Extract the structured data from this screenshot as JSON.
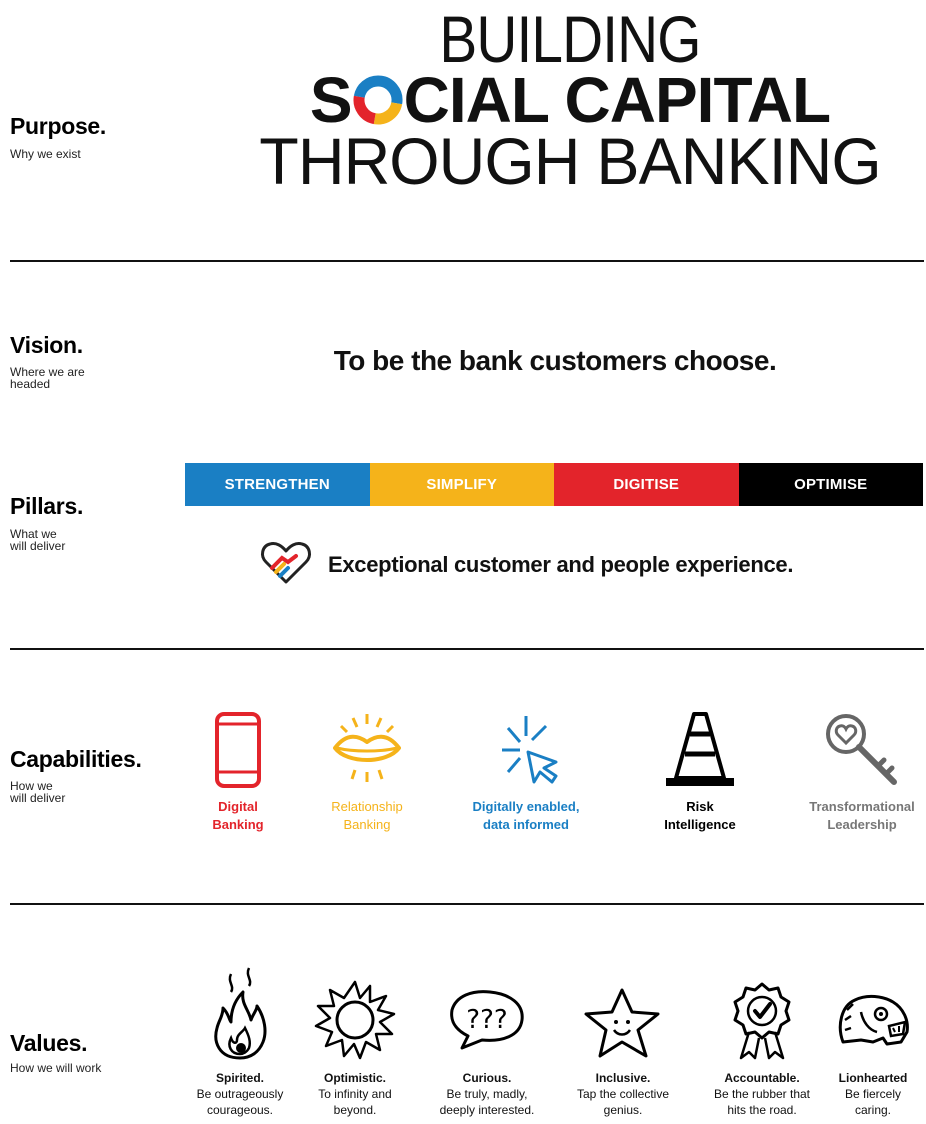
{
  "purpose": {
    "title": "Purpose.",
    "subtitle": "Why we exist",
    "line1": "BUILDING",
    "line2": "SOCIAL CAPITAL",
    "line3": "THROUGH BANKING"
  },
  "vision": {
    "title": "Vision.",
    "subtitle": "Where we are\nheaded",
    "statement": "To be the bank customers choose."
  },
  "pillars": {
    "title": "Pillars.",
    "subtitle": "What we\nwill deliver",
    "items": [
      {
        "label": "STRENGTHEN",
        "color": "#1a7fc4"
      },
      {
        "label": "SIMPLIFY",
        "color": "#f5b31a"
      },
      {
        "label": "DIGITISE",
        "color": "#e3242b"
      },
      {
        "label": "OPTIMISE",
        "color": "#000000"
      }
    ],
    "experience": "Exceptional customer and people experience."
  },
  "capabilities": {
    "title": "Capabilities.",
    "subtitle": "How we\nwill deliver",
    "items": [
      {
        "label": "Digital\nBanking",
        "icon": "phone-icon",
        "color": "#e3242b"
      },
      {
        "label": "Relationship\nBanking",
        "icon": "lips-icon",
        "color": "#f5b31a"
      },
      {
        "label": "Digitally enabled,\ndata informed",
        "icon": "cursor-click-icon",
        "color": "#1a7fc4"
      },
      {
        "label": "Risk\nIntelligence",
        "icon": "traffic-cone-icon",
        "color": "#000000"
      },
      {
        "label": "Transformational\nLeadership",
        "icon": "heart-key-icon",
        "color": "#777777"
      }
    ]
  },
  "values": {
    "title": "Values.",
    "subtitle": "How we will work",
    "items": [
      {
        "name": "Spirited.",
        "desc": "Be outrageously\ncourageous.",
        "icon": "flame-icon"
      },
      {
        "name": "Optimistic.",
        "desc": "To infinity and\nbeyond.",
        "icon": "sun-icon"
      },
      {
        "name": "Curious.",
        "desc": "Be truly, madly,\ndeeply interested.",
        "icon": "question-bubble-icon"
      },
      {
        "name": "Inclusive.",
        "desc": "Tap the collective\ngenius.",
        "icon": "smiling-star-icon"
      },
      {
        "name": "Accountable.",
        "desc": "Be the rubber that\nhits the road.",
        "icon": "rosette-check-icon"
      },
      {
        "name": "Lionhearted",
        "desc": "Be fiercely\ncaring.",
        "icon": "lion-icon"
      }
    ]
  }
}
